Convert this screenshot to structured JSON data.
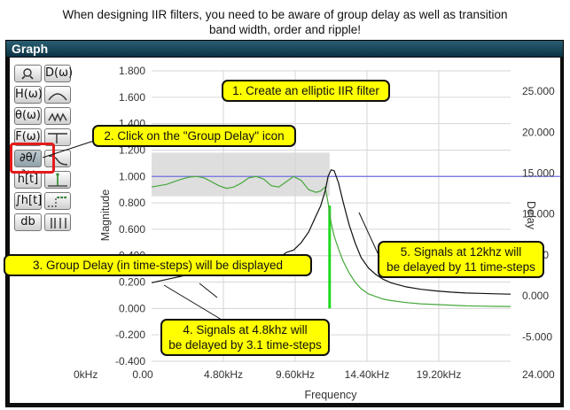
{
  "caption": {
    "line1": "When designing IIR filters, you need to be aware of group delay as well as transition",
    "line2": "band width, order and ripple!"
  },
  "window": {
    "title": "Graph"
  },
  "toolbar": {
    "buttons": [
      {
        "id": "zoom",
        "label": "",
        "icon": "zoom-icon"
      },
      {
        "id": "d",
        "label": "D(ω)"
      },
      {
        "id": "h",
        "label": "H(ω)"
      },
      {
        "id": "mag",
        "label": "",
        "icon": "magnitude-curve-icon"
      },
      {
        "id": "theta",
        "label": "θ(ω)"
      },
      {
        "id": "phase",
        "label": "",
        "icon": "phase-wave-icon"
      },
      {
        "id": "f",
        "label": "F(ω)"
      },
      {
        "id": "step",
        "label": "",
        "icon": "step-edge-icon"
      },
      {
        "id": "gd",
        "label": "∂θ/∂ω"
      },
      {
        "id": "decay",
        "label": "",
        "icon": "decay-curve-icon"
      },
      {
        "id": "ht",
        "label": "h[t]"
      },
      {
        "id": "impulse",
        "label": "",
        "icon": "impulse-icon"
      },
      {
        "id": "integral",
        "label": "∫h[t]"
      },
      {
        "id": "steprsp",
        "label": "",
        "icon": "step-response-icon"
      },
      {
        "id": "db",
        "label": "db"
      },
      {
        "id": "bars",
        "label": "",
        "icon": "bars-icon"
      }
    ]
  },
  "chart_data": {
    "type": "line",
    "xlabel": "Frequency",
    "ylabel_left": "Magnitude",
    "ylabel_right": "Delay",
    "x_unit_label": "0kHz",
    "x_ticks": [
      "0.00",
      "4.80kHz",
      "9.60kHz",
      "14.40kHz",
      "19.20kHz",
      "24.000"
    ],
    "x_tick_values": [
      0,
      4.8,
      9.6,
      14.4,
      19.2,
      24.0
    ],
    "xlim": [
      0,
      24.0
    ],
    "y_left_ticks": [
      "1.800",
      "1.600",
      "1.400",
      "1.200",
      "1.000",
      "0.800",
      "0.600",
      "0.400",
      "0.200",
      "0.000",
      "-0.200",
      "-0.400"
    ],
    "y_left_tick_values": [
      1.8,
      1.6,
      1.4,
      1.2,
      1.0,
      0.8,
      0.6,
      0.4,
      0.2,
      0.0,
      -0.2,
      -0.4
    ],
    "ylim_left": [
      -0.4,
      1.8
    ],
    "y_right_ticks": [
      "25.000",
      "20.000",
      "15.000",
      "10.000",
      "5.000",
      "0.000",
      "-5.000"
    ],
    "y_right_tick_values": [
      25,
      20,
      15,
      10,
      5,
      0,
      -5
    ],
    "ylim_right": [
      -8.0,
      27.5
    ],
    "grid": true,
    "reference_line_y": 1.0,
    "passband_region": {
      "x": [
        0,
        11.9
      ],
      "y": [
        0.85,
        1.18
      ]
    },
    "cutoff_marker_x": 11.9,
    "series": [
      {
        "axis": "left",
        "color": "#46a83c",
        "x": [
          0,
          0.5,
          1,
          1.5,
          2,
          2.5,
          3,
          3.5,
          4,
          4.5,
          5,
          5.5,
          6,
          6.5,
          7,
          7.5,
          8,
          8.5,
          9,
          9.5,
          10,
          10.5,
          11,
          11.3,
          11.6,
          11.8,
          12.0,
          12.2,
          12.5,
          12.8,
          13.2,
          13.6,
          14.0,
          14.5,
          15,
          15.5,
          16,
          17,
          18,
          19,
          20,
          21,
          22,
          23,
          24
        ],
        "y": [
          0.92,
          0.93,
          0.94,
          0.96,
          0.98,
          0.995,
          1.0,
          0.99,
          0.96,
          0.93,
          0.91,
          0.92,
          0.95,
          0.99,
          1.0,
          0.98,
          0.93,
          0.92,
          0.96,
          1.0,
          0.97,
          0.9,
          0.88,
          0.89,
          0.92,
          0.8,
          0.65,
          0.55,
          0.45,
          0.36,
          0.27,
          0.2,
          0.15,
          0.11,
          0.09,
          0.07,
          0.06,
          0.045,
          0.035,
          0.03,
          0.025,
          0.02,
          0.018,
          0.016,
          0.015
        ]
      },
      {
        "axis": "right",
        "color": "#111111",
        "x": [
          0,
          1,
          2,
          3,
          4,
          4.8,
          5.5,
          6,
          7,
          8,
          8.5,
          9,
          9.5,
          10,
          10.5,
          11,
          11.3,
          11.6,
          11.8,
          12.0,
          12.2,
          12.5,
          12.8,
          13.2,
          13.6,
          14.0,
          14.5,
          15,
          15.5,
          16,
          17,
          18,
          19,
          20,
          21,
          22,
          23,
          24
        ],
        "y": [
          1.6,
          2.0,
          2.4,
          2.8,
          3.0,
          3.1,
          3.15,
          3.3,
          3.7,
          4.2,
          4.6,
          5.3,
          5.6,
          6.5,
          7.8,
          9.8,
          11.0,
          12.8,
          14.6,
          15.4,
          15.3,
          13.8,
          11.5,
          8.7,
          6.5,
          4.7,
          3.4,
          2.6,
          2.0,
          1.6,
          1.1,
          0.8,
          0.6,
          0.45,
          0.35,
          0.3,
          0.25,
          0.2
        ]
      }
    ]
  },
  "callouts": {
    "c1": "1. Create an elliptic IIR filter",
    "c2": "2. Click on the \"Group Delay\" icon",
    "c3": "3. Group Delay (in time-steps) will be displayed",
    "c4_line1": "4. Signals at 4.8khz will",
    "c4_line2": "be delayed by 3.1 time-steps",
    "c5_line1": "5. Signals at 12khz will",
    "c5_line2": "be delayed by 11 time-steps"
  }
}
